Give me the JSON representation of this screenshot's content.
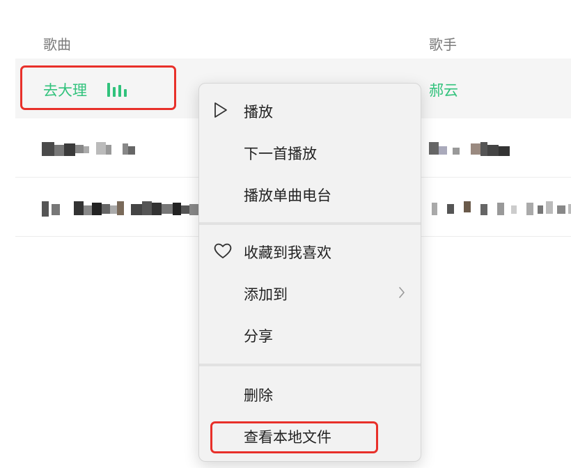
{
  "header": {
    "song_column": "歌曲",
    "artist_column": "歌手"
  },
  "rows": [
    {
      "title": "去大理",
      "artist": "郝云",
      "playing": true
    },
    {
      "title": "",
      "artist": ""
    },
    {
      "title": "",
      "artist": ""
    }
  ],
  "menu": {
    "items": [
      {
        "label": "播放",
        "icon": "play-icon"
      },
      {
        "label": "下一首播放"
      },
      {
        "label": "播放单曲电台"
      },
      {
        "label": "收藏到我喜欢",
        "icon": "heart-icon"
      },
      {
        "label": "添加到",
        "icon": "chevron-right-icon"
      },
      {
        "label": "分享"
      },
      {
        "label": "删除"
      },
      {
        "label": "查看本地文件"
      }
    ]
  },
  "colors": {
    "accent": "#31c27c",
    "highlight": "#e8302a"
  }
}
